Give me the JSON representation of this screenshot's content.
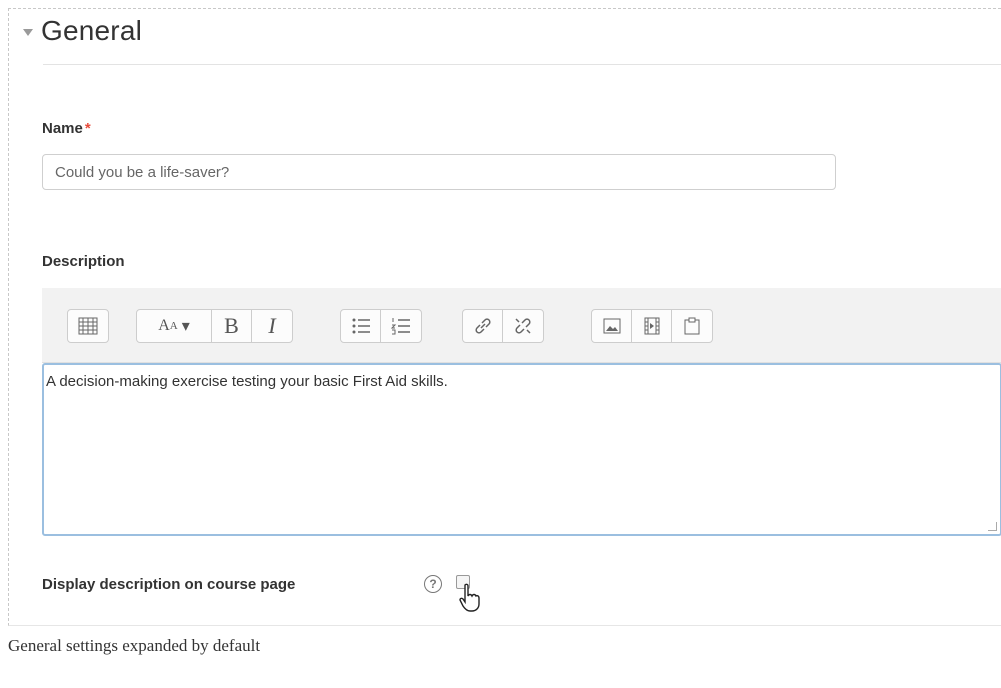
{
  "section": {
    "title": "General"
  },
  "name_field": {
    "label": "Name",
    "required_marker": "*",
    "value": "Could you be a life-saver?"
  },
  "description": {
    "label": "Description",
    "text": "A decision-making exercise testing your basic First Aid skills.",
    "toolbar_icons": [
      "toolbar-toggle-icon",
      "font-style-icon",
      "bold-icon",
      "italic-icon",
      "unordered-list-icon",
      "ordered-list-icon",
      "link-icon",
      "unlink-icon",
      "image-icon",
      "media-icon",
      "paste-icon"
    ],
    "bold_label": "B",
    "italic_label": "I"
  },
  "display_description": {
    "label": "Display description on course page",
    "help_icon": "?",
    "checked": false
  },
  "caption": "General settings expanded by default"
}
